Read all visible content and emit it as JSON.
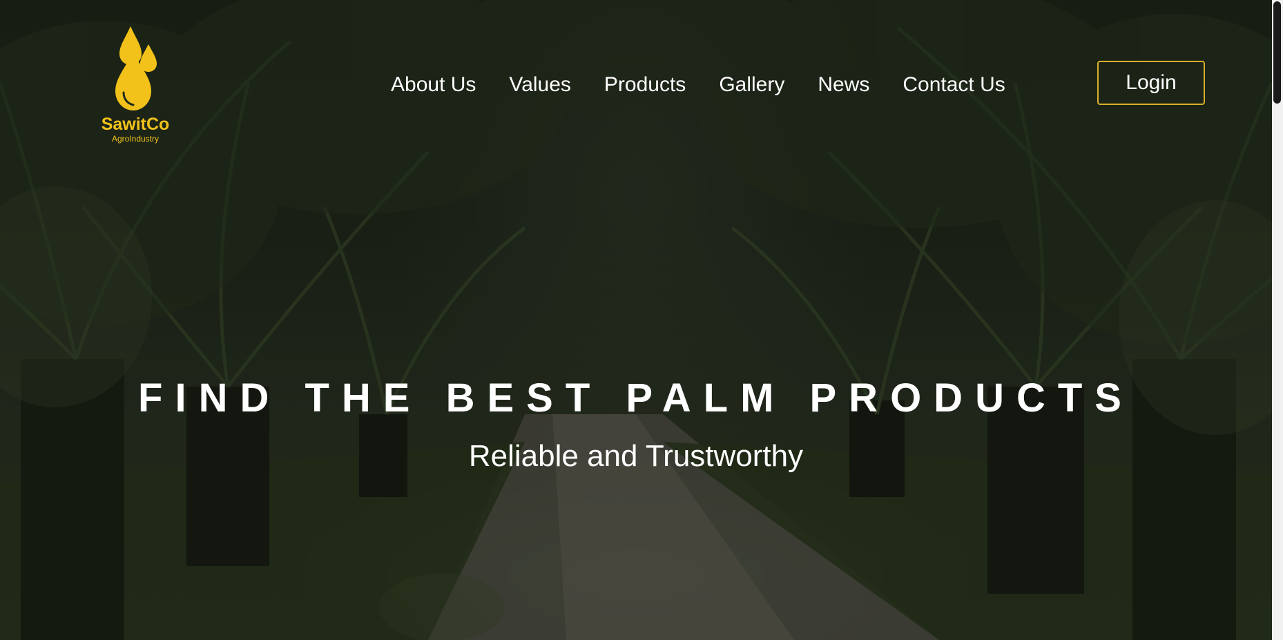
{
  "brand": {
    "name": "SawitCo",
    "tagline": "AgroIndustry",
    "color": "#f2c21a",
    "icon": "oil-drop-logo-icon"
  },
  "nav": {
    "items": [
      {
        "label": "About Us"
      },
      {
        "label": "Values"
      },
      {
        "label": "Products"
      },
      {
        "label": "Gallery"
      },
      {
        "label": "News"
      },
      {
        "label": "Contact Us"
      }
    ],
    "login_label": "Login",
    "login_border_color": "#d8b02a"
  },
  "hero": {
    "headline": "FIND THE BEST PALM PRODUCTS",
    "subheadline": "Reliable and Trustworthy",
    "background": "palm-plantation-photo"
  }
}
